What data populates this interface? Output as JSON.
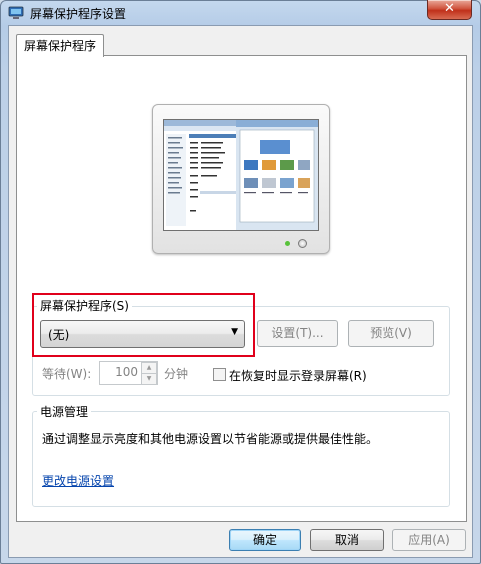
{
  "window": {
    "title": "屏幕保护程序设置",
    "close_label": "✕"
  },
  "tabs": [
    {
      "label": "屏幕保护程序",
      "active": true
    }
  ],
  "screensaver": {
    "group_label": "屏幕保护程序(S)",
    "selected": "(无)",
    "settings_button": "设置(T)...",
    "preview_button": "预览(V)",
    "wait_label": "等待(W):",
    "wait_value": "100",
    "wait_unit": "分钟",
    "resume_checkbox_label": "在恢复时显示登录屏幕(R)",
    "resume_checked": false
  },
  "power": {
    "group_label": "电源管理",
    "description": "通过调整显示亮度和其他电源设置以节省能源或提供最佳性能。",
    "link": "更改电源设置"
  },
  "footer": {
    "ok": "确定",
    "cancel": "取消",
    "apply": "应用(A)"
  },
  "colors": {
    "highlight_border": "#e0001b",
    "link": "#0645ad",
    "default_button": "#3c7fb1"
  }
}
